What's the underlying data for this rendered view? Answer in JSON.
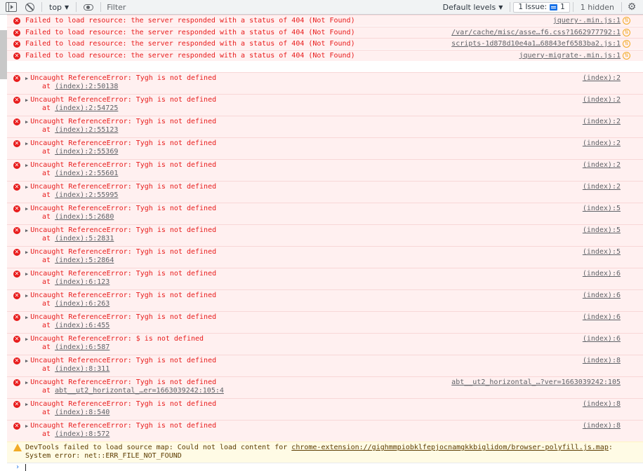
{
  "toolbar": {
    "context": "top",
    "filter_placeholder": "Filter",
    "levels": "Default levels",
    "issues_label": "1 Issue:",
    "issues_count": "1",
    "hidden": "1 hidden"
  },
  "resource_errors": [
    {
      "text": "Failed to load resource: the server responded with a status of 404 (Not Found)",
      "source": "jquery-.min.js:1"
    },
    {
      "text": "Failed to load resource: the server responded with a status of 404 (Not Found)",
      "source": "/var/cache/misc/asse…f6.css?1662977792:1"
    },
    {
      "text": "Failed to load resource: the server responded with a status of 404 (Not Found)",
      "source": "scripts-1d878d10e4a1…68843ef6583ba2.js:1"
    },
    {
      "text": "Failed to load resource: the server responded with a status of 404 (Not Found)",
      "source": "jquery-migrate-.min.js:1"
    }
  ],
  "at_prefix": "at ",
  "reference_errors": [
    {
      "text": "Uncaught ReferenceError: Tygh is not defined",
      "at": "(index):2:50138",
      "source": "(index):2"
    },
    {
      "text": "Uncaught ReferenceError: Tygh is not defined",
      "at": "(index):2:54725",
      "source": "(index):2"
    },
    {
      "text": "Uncaught ReferenceError: Tygh is not defined",
      "at": "(index):2:55123",
      "source": "(index):2"
    },
    {
      "text": "Uncaught ReferenceError: Tygh is not defined",
      "at": "(index):2:55369",
      "source": "(index):2"
    },
    {
      "text": "Uncaught ReferenceError: Tygh is not defined",
      "at": "(index):2:55601",
      "source": "(index):2"
    },
    {
      "text": "Uncaught ReferenceError: Tygh is not defined",
      "at": "(index):2:55995",
      "source": "(index):2"
    },
    {
      "text": "Uncaught ReferenceError: Tygh is not defined",
      "at": "(index):5:2680",
      "source": "(index):5"
    },
    {
      "text": "Uncaught ReferenceError: Tygh is not defined",
      "at": "(index):5:2831",
      "source": "(index):5"
    },
    {
      "text": "Uncaught ReferenceError: Tygh is not defined",
      "at": "(index):5:2864",
      "source": "(index):5"
    },
    {
      "text": "Uncaught ReferenceError: Tygh is not defined",
      "at": "(index):6:123",
      "source": "(index):6"
    },
    {
      "text": "Uncaught ReferenceError: Tygh is not defined",
      "at": "(index):6:263",
      "source": "(index):6"
    },
    {
      "text": "Uncaught ReferenceError: Tygh is not defined",
      "at": "(index):6:455",
      "source": "(index):6"
    },
    {
      "text": "Uncaught ReferenceError: $ is not defined",
      "at": "(index):6:587",
      "source": "(index):6"
    },
    {
      "text": "Uncaught ReferenceError: Tygh is not defined",
      "at": "(index):8:311",
      "source": "(index):8"
    },
    {
      "text": "Uncaught ReferenceError: Tygh is not defined",
      "at": "abt__ut2_horizontal_…er=1663039242:105:4",
      "source": "abt__ut2_horizontal_…?ver=1663039242:105"
    },
    {
      "text": "Uncaught ReferenceError: Tygh is not defined",
      "at": "(index):8:540",
      "source": "(index):8"
    },
    {
      "text": "Uncaught ReferenceError: Tygh is not defined",
      "at": "(index):8:572",
      "source": "(index):8"
    }
  ],
  "warning": {
    "prefix": "DevTools failed to load source map: Could not load content for ",
    "link": "chrome-extension://gighmmpiobklfepjocnamgkkbiglidom/browser-polyfill.js.map",
    "suffix": ": System error: net::ERR_FILE_NOT_FOUND"
  },
  "prompt": "›"
}
